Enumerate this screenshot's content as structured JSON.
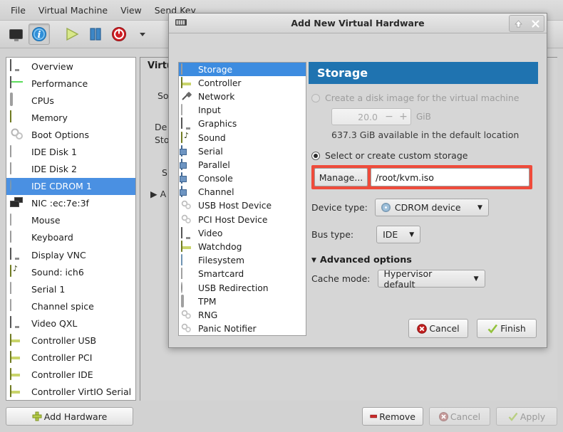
{
  "menubar": {
    "items": [
      "File",
      "Virtual Machine",
      "View",
      "Send Key"
    ]
  },
  "toolbar": {
    "buttons": [
      {
        "name": "show-console-icon",
        "label": ""
      },
      {
        "name": "show-details-icon",
        "label": ""
      },
      {
        "name": "run-icon",
        "label": ""
      },
      {
        "name": "pause-icon",
        "label": ""
      },
      {
        "name": "shutdown-icon",
        "label": ""
      },
      {
        "name": "shutdown-dropdown-icon",
        "label": ""
      },
      {
        "name": "snapshots-icon",
        "label": ""
      }
    ]
  },
  "hardware_list": {
    "items": [
      {
        "label": "Overview",
        "icon": "monitor-icon"
      },
      {
        "label": "Performance",
        "icon": "performance-icon"
      },
      {
        "label": "CPUs",
        "icon": "cpu-icon"
      },
      {
        "label": "Memory",
        "icon": "memory-icon"
      },
      {
        "label": "Boot Options",
        "icon": "gears-icon"
      },
      {
        "label": "IDE Disk 1",
        "icon": "disk-icon"
      },
      {
        "label": "IDE Disk 2",
        "icon": "disk-icon"
      },
      {
        "label": "IDE CDROM 1",
        "icon": "cdrom-icon",
        "selected": true
      },
      {
        "label": "NIC :ec:7e:3f",
        "icon": "nic-icon"
      },
      {
        "label": "Mouse",
        "icon": "mouse-icon"
      },
      {
        "label": "Keyboard",
        "icon": "keyboard-icon"
      },
      {
        "label": "Display VNC",
        "icon": "monitor-icon"
      },
      {
        "label": "Sound: ich6",
        "icon": "soundcard-icon"
      },
      {
        "label": "Serial 1",
        "icon": "smartcard-icon"
      },
      {
        "label": "Channel spice",
        "icon": "smartcard-icon"
      },
      {
        "label": "Video QXL",
        "icon": "monitor-icon"
      },
      {
        "label": "Controller USB",
        "icon": "card-icon"
      },
      {
        "label": "Controller PCI",
        "icon": "card-icon"
      },
      {
        "label": "Controller IDE",
        "icon": "card-icon"
      },
      {
        "label": "Controller VirtIO Serial",
        "icon": "card-icon"
      }
    ]
  },
  "detail_pane": {
    "title": "Virtu",
    "line1": "So",
    "line2": "De",
    "line3": "Sto",
    "line4": "S",
    "line5": "▶ A"
  },
  "bottom_bar": {
    "add_hardware": "Add Hardware",
    "remove": "Remove",
    "cancel": "Cancel",
    "apply": "Apply"
  },
  "dialog": {
    "title": "Add New Virtual Hardware",
    "window_buttons": {
      "maximize": "⬆",
      "close": "✕"
    },
    "categories": [
      {
        "label": "Storage",
        "icon": "disk-icon",
        "selected": true
      },
      {
        "label": "Controller",
        "icon": "card-icon"
      },
      {
        "label": "Network",
        "icon": "plug-icon"
      },
      {
        "label": "Input",
        "icon": "input-icon"
      },
      {
        "label": "Graphics",
        "icon": "monitor-icon"
      },
      {
        "label": "Sound",
        "icon": "soundcard-icon"
      },
      {
        "label": "Serial",
        "icon": "serial-icon"
      },
      {
        "label": "Parallel",
        "icon": "serial-icon"
      },
      {
        "label": "Console",
        "icon": "serial-icon"
      },
      {
        "label": "Channel",
        "icon": "serial-icon"
      },
      {
        "label": "USB Host Device",
        "icon": "gears-icon"
      },
      {
        "label": "PCI Host Device",
        "icon": "gears-icon"
      },
      {
        "label": "Video",
        "icon": "monitor-icon"
      },
      {
        "label": "Watchdog",
        "icon": "card-icon"
      },
      {
        "label": "Filesystem",
        "icon": "folder-icon"
      },
      {
        "label": "Smartcard",
        "icon": "smartcard-icon"
      },
      {
        "label": "USB Redirection",
        "icon": "usb-redirect-icon"
      },
      {
        "label": "TPM",
        "icon": "tpm-icon"
      },
      {
        "label": "RNG",
        "icon": "gears-icon"
      },
      {
        "label": "Panic Notifier",
        "icon": "gears-icon"
      }
    ],
    "panel": {
      "heading": "Storage",
      "create_disk_label": "Create a disk image for the virtual machine",
      "create_disk_selected": false,
      "size_value": "20.0",
      "size_unit": "GiB",
      "size_minus": "−",
      "size_plus": "+",
      "available_text": "637.3 GiB available in the default location",
      "custom_storage_label": "Select or create custom storage",
      "custom_storage_selected": true,
      "manage_button": "Manage...",
      "path_value": "/root/kvm.iso",
      "device_type_label": "Device type:",
      "device_type_value": "CDROM device",
      "bus_type_label": "Bus type:",
      "bus_type_value": "IDE",
      "advanced_options_label": "Advanced options",
      "advanced_expanded": true,
      "cache_mode_label": "Cache mode:",
      "cache_mode_value": "Hypervisor default",
      "highlight_color": "#ef4b3b"
    },
    "footer": {
      "cancel": "Cancel",
      "finish": "Finish"
    }
  },
  "colors": {
    "selection_blue": "#4a90e2",
    "panel_header_blue": "#1f73b0",
    "highlight_red": "#ef4b3b",
    "window_bg": "#d2d2d2"
  }
}
